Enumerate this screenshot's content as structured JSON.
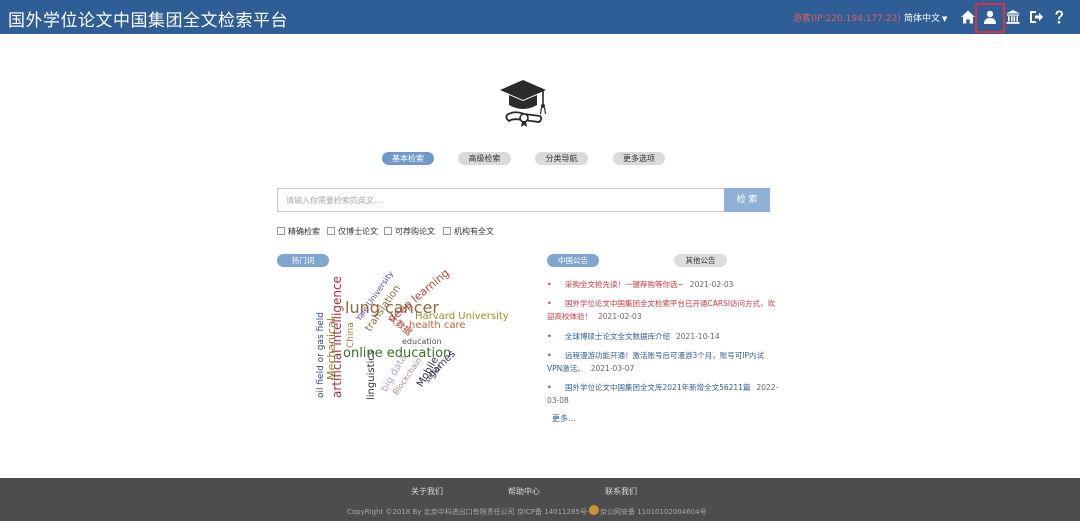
{
  "header": {
    "title": "国外学位论文中国集团全文检索平台",
    "visitor": "游客(IP:220.194.177.22)",
    "language": "简体中文",
    "icons": [
      "home-icon",
      "user-icon",
      "institution-icon",
      "logout-icon",
      "help-icon"
    ],
    "highlight_color": "#d9333f",
    "bar_color": "#2f5d95"
  },
  "tabs": [
    {
      "label": "基本检索",
      "active": true
    },
    {
      "label": "高级检索",
      "active": false
    },
    {
      "label": "分类导航",
      "active": false
    },
    {
      "label": "更多选项",
      "active": false
    }
  ],
  "search": {
    "placeholder": "请输入你需要检索的英文...",
    "button": "检 索"
  },
  "options": [
    "精确检索",
    "仅博士论文",
    "可荐购论文",
    "机构有全文"
  ],
  "hotwords": {
    "label": "热门词",
    "words": [
      {
        "text": "lung cancer",
        "color": "#8e6c3c"
      },
      {
        "text": "online education",
        "color": "#3a6f26"
      },
      {
        "text": "artificial intelligence",
        "color": "#a8323a"
      },
      {
        "text": "Mechanical",
        "color": "#8a8a32"
      },
      {
        "text": "oil field or gas field",
        "color": "#2f4e86"
      },
      {
        "text": "Harvard University",
        "color": "#9c8f26"
      },
      {
        "text": "deep learning",
        "color": "#b0453a"
      },
      {
        "text": "health care",
        "color": "#c2653a"
      },
      {
        "text": "linguistics",
        "color": "#333333"
      },
      {
        "text": "big data",
        "color": "#b9a6cf"
      },
      {
        "text": "Mobile",
        "color": "#2a2a4a"
      },
      {
        "text": "games",
        "color": "#33335a"
      },
      {
        "text": "education",
        "color": "#555555"
      },
      {
        "text": "Yale University",
        "color": "#6a4c9c"
      },
      {
        "text": "translation",
        "color": "#8e6c3c"
      },
      {
        "text": "大数据",
        "color": "#b53a2a"
      },
      {
        "text": "Blockchain",
        "color": "#b68a8a"
      },
      {
        "text": "senior",
        "color": "#444444"
      },
      {
        "text": "China",
        "color": "#8a8a32"
      }
    ]
  },
  "notices": {
    "tab_china": "中国公告",
    "tab_other": "其他公告",
    "items": [
      {
        "text": "采购全文抢先读！一键荐购等你选~",
        "date": "2021-02-03",
        "color": "#d0343f"
      },
      {
        "text": "国外学位论文中国集团全文检索平台已开通CARSI访问方式，欢迎高校体验！",
        "date": "2021-02-03",
        "color": "#d0343f"
      },
      {
        "text": "全球博硕士论文全文数据库介绍",
        "date": "2021-10-14",
        "color": "#2f5d95"
      },
      {
        "text": "远程漫游功能开通！激活账号后可漫游3个月，账号可IP内试VPN激活。",
        "date": "2021-03-07",
        "color": "#2f5d95"
      },
      {
        "text": "国外学位论文中国集团全文库2021年新增全文56211篇",
        "date": "2022-03-08",
        "color": "#2f5d95"
      }
    ],
    "more": "更多..."
  },
  "footer": {
    "links": [
      "关于我们",
      "帮助中心",
      "联系我们"
    ],
    "copyright": "CopyRight ©2018 By 北京中科进出口有限责任公司 京ICP备 14011285号-2",
    "police": "京公网安备 11010102004604号"
  }
}
